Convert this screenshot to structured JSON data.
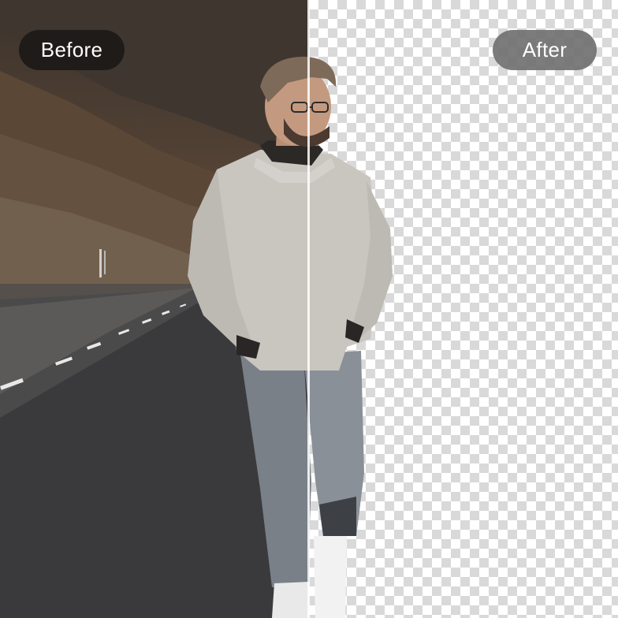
{
  "labels": {
    "before": "Before",
    "after": "After"
  },
  "colors": {
    "checker_light": "#ffffff",
    "checker_dark": "#d9d9d9",
    "before_pill": "#191614",
    "after_pill": "#6e6e6e",
    "divider": "#ffffff"
  },
  "compare": {
    "split_percent": 50
  }
}
